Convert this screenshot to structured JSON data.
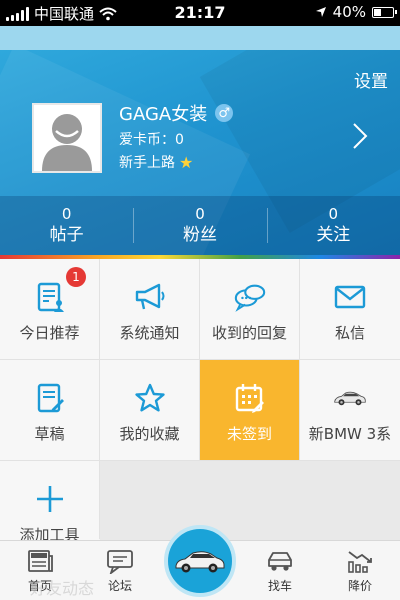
{
  "status_bar": {
    "carrier": "中国联通",
    "time": "21:17",
    "battery": "40%",
    "battery_level": 0.4
  },
  "profile": {
    "settings_label": "设置",
    "username": "GAGA女装",
    "gender_icon": "male-icon",
    "coins": "爱卡币：0",
    "rank": "新手上路",
    "rank_icon": "star-icon"
  },
  "stats": [
    {
      "count": "0",
      "label": "帖子"
    },
    {
      "count": "0",
      "label": "粉丝"
    },
    {
      "count": "0",
      "label": "关注"
    }
  ],
  "grid": [
    {
      "label": "今日推荐",
      "icon": "recommend-doc-icon",
      "badge": "1"
    },
    {
      "label": "系统通知",
      "icon": "megaphone-icon"
    },
    {
      "label": "收到的回复",
      "icon": "chat-bubbles-icon"
    },
    {
      "label": "私信",
      "icon": "envelope-icon"
    },
    {
      "label": "草稿",
      "icon": "draft-edit-icon"
    },
    {
      "label": "我的收藏",
      "icon": "star-outline-icon"
    },
    {
      "label": "未签到",
      "icon": "calendar-edit-icon",
      "active": true
    },
    {
      "label": "新BMW 3系",
      "icon": "bmw-car-icon"
    },
    {
      "label": "添加工具",
      "icon": "plus-icon"
    }
  ],
  "tabbar": [
    {
      "label": "首页",
      "icon": "news-icon"
    },
    {
      "label": "论坛",
      "icon": "forum-icon"
    },
    {
      "label": "",
      "icon": "car-center-icon"
    },
    {
      "label": "找车",
      "icon": "find-car-icon"
    },
    {
      "label": "降价",
      "icon": "price-drop-icon"
    }
  ],
  "watermark": "好友动态",
  "colors": {
    "header_blue": "#1f93cf",
    "icon_blue": "#1c9ad6",
    "active_orange": "#f9b62e",
    "badge_red": "#e53935"
  }
}
